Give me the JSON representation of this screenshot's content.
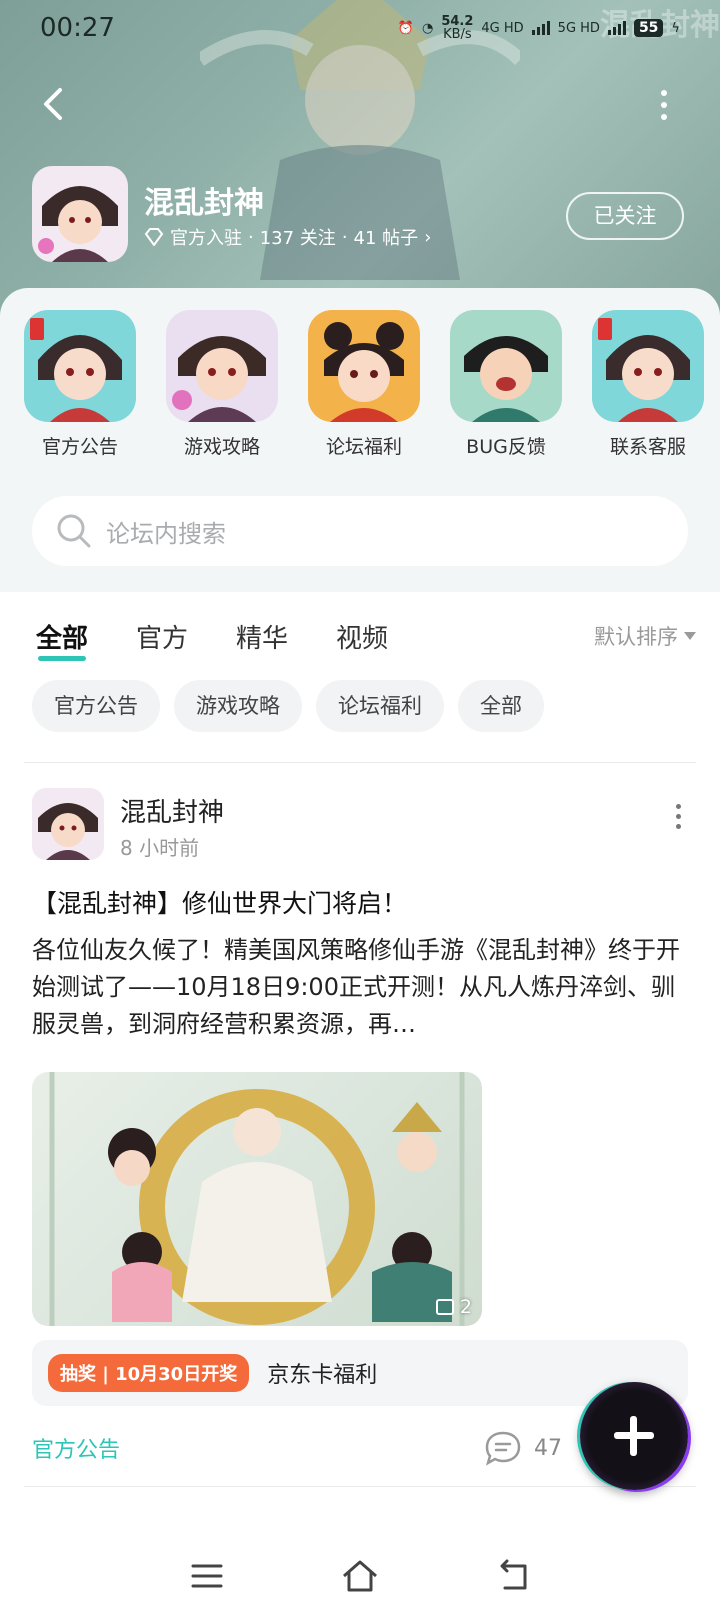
{
  "status_bar": {
    "time": "00:27",
    "net_speed_value": "54.2",
    "net_speed_unit": "KB/s",
    "net1": "4G HD",
    "net2": "5G HD",
    "battery": "55"
  },
  "banner": {
    "logo_text": "混乱封神"
  },
  "forum": {
    "name": "混乱封神",
    "official_label": "官方入驻",
    "follow_count": "137 关注",
    "post_count": "41 帖子",
    "sep": "·",
    "follow_button": "已关注"
  },
  "quick_links": [
    {
      "label": "官方公告"
    },
    {
      "label": "游戏攻略"
    },
    {
      "label": "论坛福利"
    },
    {
      "label": "BUG反馈"
    },
    {
      "label": "联系客服"
    }
  ],
  "search": {
    "placeholder": "论坛内搜索"
  },
  "tabs": [
    {
      "label": "全部",
      "active": true
    },
    {
      "label": "官方"
    },
    {
      "label": "精华"
    },
    {
      "label": "视频"
    }
  ],
  "sort_label": "默认排序",
  "chips": [
    "官方公告",
    "游戏攻略",
    "论坛福利",
    "全部"
  ],
  "post": {
    "author": "混乱封神",
    "time": "8 小时前",
    "title": "【混乱封神】修仙世界大门将启！",
    "body": "各位仙友久候了！精美国风策略修仙手游《混乱封神》终于开始测试了——10月18日9:00正式开测！从凡人炼丹淬剑、驯服灵兽，到洞府经营积累资源，再…",
    "image_count": "2",
    "lottery_badge": "抽奖 | 10月30日开奖",
    "lottery_text": "京东卡福利",
    "tag": "官方公告",
    "comment_count": "47"
  },
  "colors": {
    "accent": "#2ec5b6",
    "lottery": "#f56a3a",
    "banner": "#8fb0a8"
  },
  "icons": {
    "back": "chevron-left-icon",
    "more": "more-vertical-icon",
    "search": "search-icon",
    "comment": "comment-icon",
    "add": "plus-icon"
  }
}
